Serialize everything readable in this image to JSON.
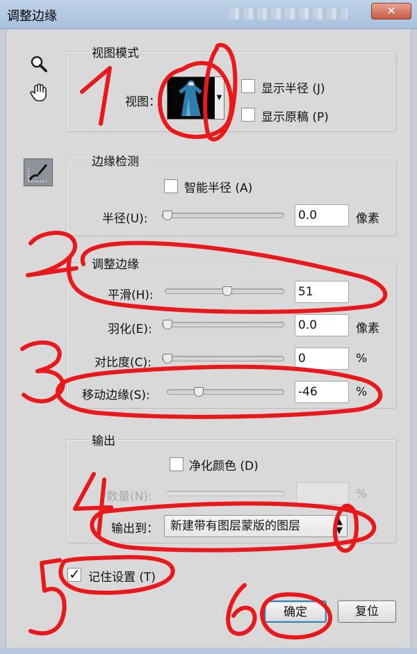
{
  "window": {
    "title": "调整边缘",
    "close_label": "✕"
  },
  "view_mode": {
    "title": "视图模式",
    "view_label": "视图：",
    "show_radius_label": "显示半径 (J)",
    "show_radius_checked": false,
    "show_original_label": "显示原稿 (P)",
    "show_original_checked": false
  },
  "edge_detection": {
    "title": "边缘检测",
    "smart_radius_label": "智能半径 (A)",
    "smart_radius_checked": false,
    "radius_label": "半径(U):",
    "radius_value": "0.0",
    "radius_unit": "像素"
  },
  "adjust_edge": {
    "title": "调整边缘",
    "smooth_label": "平滑(H):",
    "smooth_value": "51",
    "feather_label": "羽化(E):",
    "feather_value": "0.0",
    "feather_unit": "像素",
    "contrast_label": "对比度(C):",
    "contrast_value": "0",
    "contrast_unit": "%",
    "shift_edge_label": "移动边缘(S):",
    "shift_edge_value": "-46",
    "shift_edge_unit": "%"
  },
  "output": {
    "title": "输出",
    "decontaminate_label": "净化颜色 (D)",
    "decontaminate_checked": false,
    "amount_label": "数量(N):",
    "amount_unit": "%",
    "output_to_label": "输出到：",
    "output_to_value": "新建带有图层蒙版的图层"
  },
  "remember": {
    "label": "记住设置 (T)",
    "checked": true
  },
  "buttons": {
    "ok": "确定",
    "reset": "复位"
  },
  "annotations": {
    "color": "#e8181b",
    "numbers": [
      "1",
      "2",
      "3",
      "4",
      "5",
      "6"
    ]
  },
  "icons": [
    "zoom-icon",
    "hand-icon",
    "refine-radius-brush-icon",
    "chevron-down-icon",
    "up-down-arrows-icon"
  ]
}
